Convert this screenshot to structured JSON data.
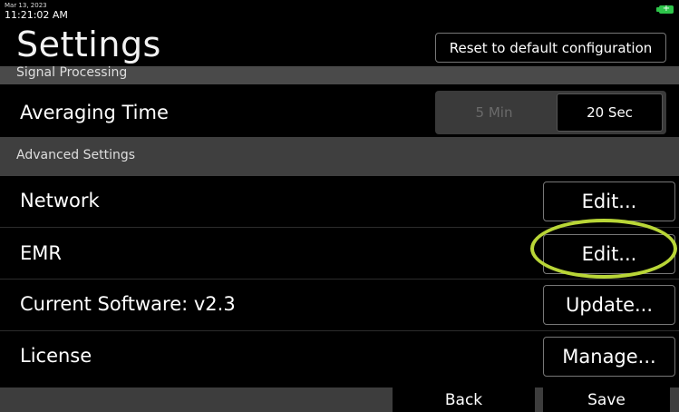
{
  "status": {
    "date": "Mar 13, 2023",
    "time": "11:21:02 AM",
    "battery_icon": "battery-charging-icon",
    "battery_color": "#2ec44a"
  },
  "header": {
    "title": "Settings",
    "reset_label": "Reset to default configuration"
  },
  "signal_processing": {
    "section_label": "Signal Processing",
    "averaging_label": "Averaging Time",
    "options": [
      "5 Min",
      "20 Sec"
    ],
    "selected": "20 Sec"
  },
  "advanced": {
    "section_label": "Advanced Settings",
    "rows": [
      {
        "label": "Network",
        "button": "Edit..."
      },
      {
        "label": "EMR",
        "button": "Edit..."
      },
      {
        "label": "Current Software: v2.3",
        "button": "Update..."
      },
      {
        "label": "License",
        "button": "Manage..."
      }
    ]
  },
  "annotation": {
    "highlight_color": "#b9d637"
  },
  "footer": {
    "back_label": "Back",
    "save_label": "Save"
  }
}
